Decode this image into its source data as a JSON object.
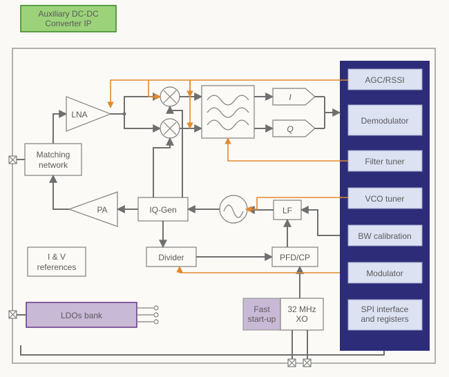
{
  "title": "Auxiliary DC-DC Converter IP",
  "blocks": {
    "lna": "LNA",
    "matching": "Matching\nnetwork",
    "pa": "PA",
    "iqgen": "IQ-Gen",
    "divider": "Divider",
    "lf": "LF",
    "pfdcp": "PFD/CP",
    "iv": "I & V\nreferences",
    "ldos": "LDOs bank",
    "fast": "Fast\nstart-up",
    "xo": "32 MHz\nXO",
    "i": "I",
    "q": "Q"
  },
  "side": {
    "agc": "AGC/RSSI",
    "demod": "Demodulator",
    "ftune": "Filter tuner",
    "vtune": "VCO tuner",
    "bwcal": "BW calibration",
    "mod": "Modulator",
    "spi": "SPI interface\nand registers"
  }
}
